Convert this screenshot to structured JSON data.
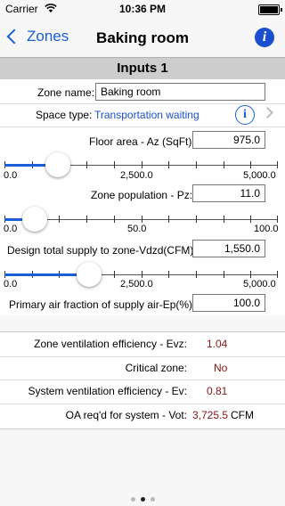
{
  "status": {
    "carrier": "Carrier",
    "time": "10:36 PM"
  },
  "nav": {
    "back_label": "Zones",
    "title": "Baking room"
  },
  "section": {
    "title": "Inputs 1"
  },
  "inputs": {
    "zone_name_label": "Zone name:",
    "zone_name_value": "Baking room",
    "space_type_label": "Space type:",
    "space_type_value": "Transportation waiting",
    "floor_area_label": "Floor area - Az (SqFt):",
    "floor_area_value": "975.0",
    "floor_area_slider": {
      "min_label": "0.0",
      "mid_label": "2,500.0",
      "max_label": "5,000.0",
      "value": 975,
      "min": 0,
      "max": 5000
    },
    "zone_population_label": "Zone population - Pz:",
    "zone_population_value": "11.0",
    "zone_population_slider": {
      "min_label": "0.0",
      "mid_label": "50.0",
      "max_label": "100.0",
      "value": 11,
      "min": 0,
      "max": 100
    },
    "design_supply_label": "Design total supply to zone-Vdzd(CFM):",
    "design_supply_value": "1,550.0",
    "design_supply_slider": {
      "min_label": "0.0",
      "mid_label": "2,500.0",
      "max_label": "5,000.0",
      "value": 1550,
      "min": 0,
      "max": 5000
    },
    "primary_air_label": "Primary air fraction of supply air-Ep(%):",
    "primary_air_value": "100.0"
  },
  "results": {
    "zone_eff_label": "Zone ventilation efficiency - Evz:",
    "zone_eff_value": "1.04",
    "critical_label": "Critical zone:",
    "critical_value": "No",
    "system_eff_label": "System ventilation efficiency - Ev:",
    "system_eff_value": "0.81",
    "oa_label": "OA req'd for system - Vot:",
    "oa_value": "3,725.5",
    "oa_unit": "CFM"
  },
  "colors": {
    "accent": "#1a5fd8",
    "result_value": "#8a1414"
  }
}
